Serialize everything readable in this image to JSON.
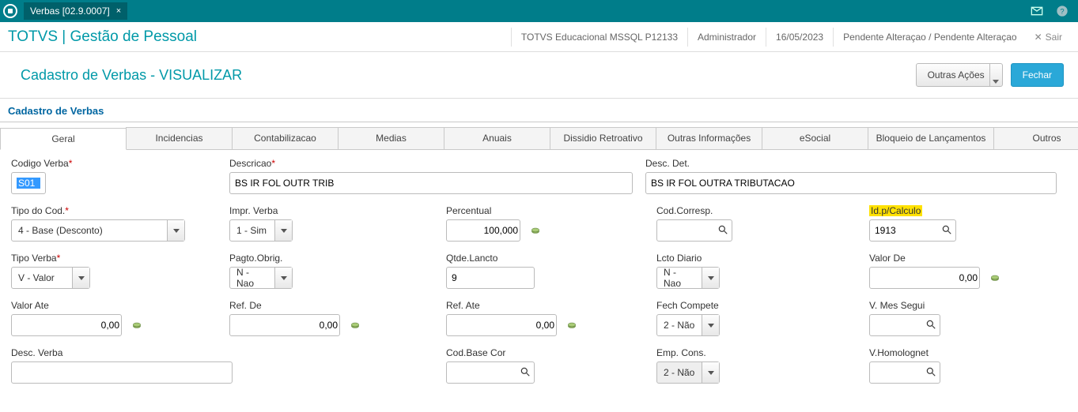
{
  "topbar": {
    "tab_label": "Verbas [02.9.0007]"
  },
  "header": {
    "app_title": "TOTVS | Gestão de Pessoal",
    "context_env": "TOTVS Educacional MSSQL P12133",
    "user": "Administrador",
    "date": "16/05/2023",
    "pending": "Pendente Alteraçao / Pendente Alteraçao",
    "exit": "Sair"
  },
  "subheader": {
    "title": "Cadastro de Verbas - VISUALIZAR",
    "other_actions": "Outras Ações",
    "close": "Fechar"
  },
  "section_title": "Cadastro de Verbas",
  "tabs": {
    "geral": "Geral",
    "incidencias": "Incidencias",
    "contabilizacao": "Contabilizacao",
    "medias": "Medias",
    "anuais": "Anuais",
    "dissidio": "Dissidio Retroativo",
    "outrasinfo": "Outras Informações",
    "esocial": "eSocial",
    "bloqueio": "Bloqueio de Lançamentos",
    "outros": "Outros"
  },
  "form": {
    "codigo_verba": {
      "label": "Codigo Verba",
      "value": "S01"
    },
    "descricao": {
      "label": "Descricao",
      "value": "BS IR FOL OUTR TRIB"
    },
    "desc_det": {
      "label": "Desc. Det.",
      "value": "BS IR FOL OUTRA TRIBUTACAO"
    },
    "tipo_cod": {
      "label": "Tipo do Cod.",
      "value": "4 - Base (Desconto)"
    },
    "impr_verba": {
      "label": "Impr. Verba",
      "value": "1 - Sim"
    },
    "percentual": {
      "label": "Percentual",
      "value": "100,000"
    },
    "cod_corresp": {
      "label": "Cod.Corresp.",
      "value": ""
    },
    "id_calculo": {
      "label": "Id.p/Calculo",
      "value": "1913"
    },
    "tipo_verba": {
      "label": "Tipo Verba",
      "value": "V - Valor"
    },
    "pagto_obrig": {
      "label": "Pagto.Obrig.",
      "value": "N - Nao"
    },
    "qtde_lancto": {
      "label": "Qtde.Lancto",
      "value": "9"
    },
    "lcto_diario": {
      "label": "Lcto Diario",
      "value": "N - Nao"
    },
    "valor_de": {
      "label": "Valor De",
      "value": "0,00"
    },
    "valor_ate": {
      "label": "Valor Ate",
      "value": "0,00"
    },
    "ref_de": {
      "label": "Ref. De",
      "value": "0,00"
    },
    "ref_ate": {
      "label": "Ref. Ate",
      "value": "0,00"
    },
    "fech_compete": {
      "label": "Fech Compete",
      "value": "2 - Não"
    },
    "v_mes_segui": {
      "label": "V. Mes Segui",
      "value": ""
    },
    "desc_verba": {
      "label": "Desc. Verba",
      "value": ""
    },
    "cod_base_cor": {
      "label": "Cod.Base Cor",
      "value": ""
    },
    "emp_cons": {
      "label": "Emp. Cons.",
      "value": "2 - Não"
    },
    "v_homolognet": {
      "label": "V.Homolognet",
      "value": ""
    }
  }
}
